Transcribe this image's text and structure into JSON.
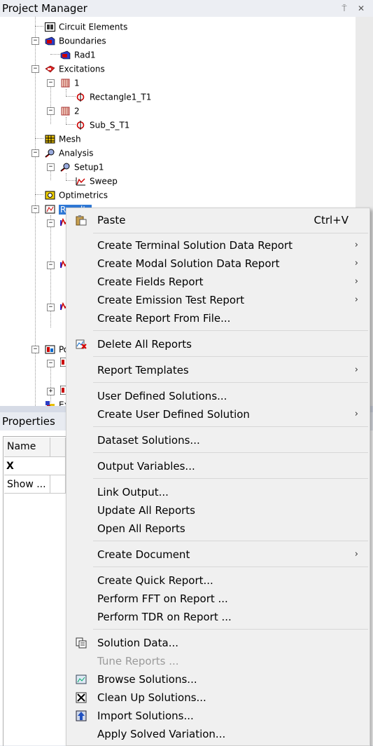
{
  "project_manager": {
    "title": "Project Manager",
    "pin_glyph": "⍑",
    "close_glyph": "✕"
  },
  "tree": {
    "circuit_elements": "Circuit Elements",
    "boundaries": "Boundaries",
    "rad1": "Rad1",
    "excitations": "Excitations",
    "exc1": "1",
    "rect1": "Rectangle1_T1",
    "exc2": "2",
    "sub": "Sub_S_T1",
    "mesh": "Mesh",
    "analysis": "Analysis",
    "setup1": "Setup1",
    "sweep": "Sweep",
    "optimetrics": "Optimetrics",
    "results": "Results",
    "po_partial": "Po",
    "ex_partial": "Ex",
    "expand_minus": "−",
    "expand_plus": "+"
  },
  "properties": {
    "title": "Properties",
    "col_name": "Name",
    "row1_name": "X Scrollbar",
    "row2_name": "Show ..."
  },
  "menu": {
    "paste": "Paste",
    "paste_shortcut": "Ctrl+V",
    "create_terminal": "Create Terminal Solution Data Report",
    "create_modal": "Create Modal Solution Data Report",
    "create_fields": "Create Fields Report",
    "create_emission": "Create Emission Test Report",
    "create_from_file": "Create Report From File...",
    "delete_all": "Delete All Reports",
    "report_templates": "Report Templates",
    "user_defined": "User Defined Solutions...",
    "create_user_defined": "Create User Defined Solution",
    "dataset_solutions": "Dataset Solutions...",
    "output_variables": "Output Variables...",
    "link_output": "Link Output...",
    "update_all": "Update All Reports",
    "open_all": "Open All Reports",
    "create_document": "Create Document",
    "create_quick": "Create Quick Report...",
    "perform_fft": "Perform FFT on Report ...",
    "perform_tdr": "Perform TDR on Report ...",
    "solution_data": "Solution Data...",
    "tune_reports": "Tune Reports ...",
    "browse_solutions": "Browse Solutions...",
    "clean_up": "Clean Up Solutions...",
    "import_solutions": "Import Solutions...",
    "apply_solved": "Apply Solved Variation...",
    "submenu_arrow": "›"
  }
}
